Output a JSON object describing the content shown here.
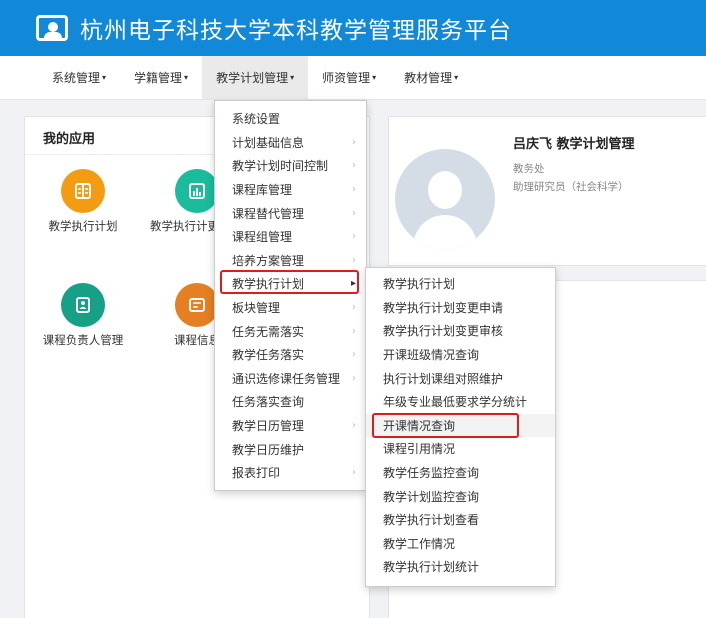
{
  "header": {
    "title": "杭州电子科技大学本科教学管理服务平台"
  },
  "nav": {
    "items": [
      {
        "label": "系统管理",
        "caret": "▾"
      },
      {
        "label": "学籍管理",
        "caret": "▾"
      },
      {
        "label": "教学计划管理",
        "caret": "▾"
      },
      {
        "label": "师资管理",
        "caret": "▾"
      },
      {
        "label": "教材管理",
        "caret": "▾"
      }
    ]
  },
  "my_apps": {
    "title": "我的应用",
    "apps": [
      {
        "label": "教学执行计划",
        "icon": "book-icon",
        "color": "#f39c12"
      },
      {
        "label": "教学执行计更...",
        "icon": "chart-icon",
        "color": "#1abc9c"
      },
      {
        "label": "课程负责人管理",
        "icon": "contact-icon",
        "color": "#16a085"
      },
      {
        "label": "课程信息",
        "icon": "list-icon",
        "color": "#e67e22"
      }
    ]
  },
  "profile": {
    "name": "吕庆飞  教学计划管理",
    "department": "教务处",
    "title": "助理研究员（社会科学）"
  },
  "dropdown": {
    "items": [
      {
        "label": "系统设置",
        "arrow": ""
      },
      {
        "label": "计划基础信息",
        "arrow": "›"
      },
      {
        "label": "教学计划时间控制",
        "arrow": "›"
      },
      {
        "label": "课程库管理",
        "arrow": "›"
      },
      {
        "label": "课程替代管理",
        "arrow": "›"
      },
      {
        "label": "课程组管理",
        "arrow": "›"
      },
      {
        "label": "培养方案管理",
        "arrow": "›"
      },
      {
        "label": "教学执行计划",
        "arrow": "▸"
      },
      {
        "label": "板块管理",
        "arrow": "›"
      },
      {
        "label": "任务无需落实",
        "arrow": "›"
      },
      {
        "label": "教学任务落实",
        "arrow": "›"
      },
      {
        "label": "通识选修课任务管理",
        "arrow": "›"
      },
      {
        "label": "任务落实查询",
        "arrow": ""
      },
      {
        "label": "教学日历管理",
        "arrow": "›"
      },
      {
        "label": "教学日历维护",
        "arrow": ""
      },
      {
        "label": "报表打印",
        "arrow": "›"
      }
    ]
  },
  "submenu": {
    "items": [
      "教学执行计划",
      "教学执行计划变更申请",
      "教学执行计划变更审核",
      "开课班级情况查询",
      "执行计划课组对照维护",
      "年级专业最低要求学分统计",
      "开课情况查询",
      "课程引用情况",
      "教学任务监控查询",
      "教学计划监控查询",
      "教学执行计划查看",
      "教学工作情况",
      "教学执行计划统计"
    ]
  },
  "colors": {
    "header_bg": "#1188d8",
    "highlight_border": "#e01b1b"
  }
}
